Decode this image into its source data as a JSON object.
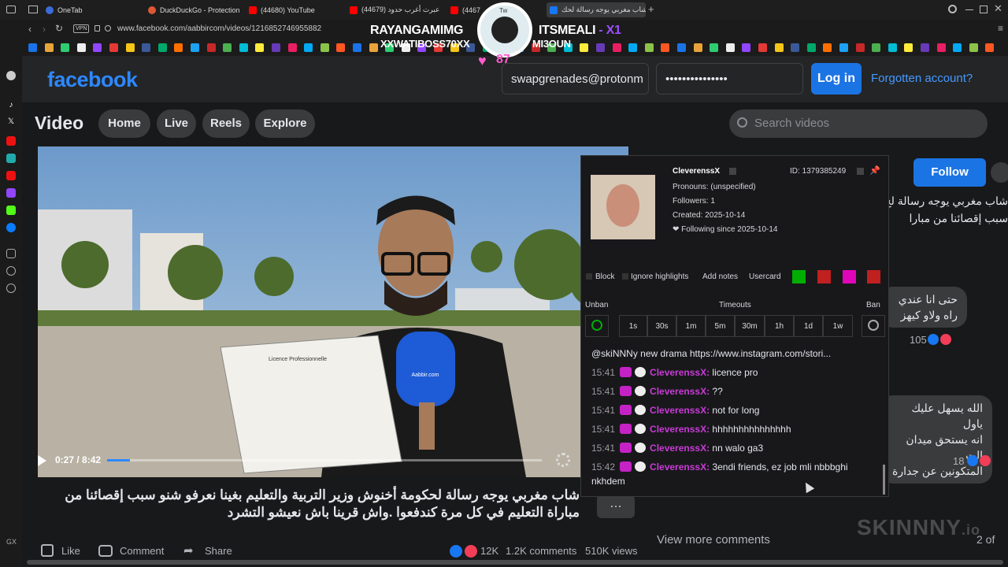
{
  "browser": {
    "tabs": [
      {
        "label": "OneTab",
        "color": "#3b6bd8"
      },
      {
        "label": "DuckDuckGo - Protection",
        "color": "#de5833"
      },
      {
        "label": "(44680) YouTube",
        "color": "#ff0000"
      },
      {
        "label": "(44679) عبرت أغرب حدود",
        "color": "#ff0000"
      },
      {
        "label": "(4467",
        "color": "#ff0000"
      },
      {
        "label": "شاب مغربي يوجه رسالة لحك",
        "color": "#1877f2"
      }
    ],
    "vpn_label": "VPN",
    "url": "www.facebook.com/aabbircom/videos/1216852746955882"
  },
  "overlay": {
    "left_name": "RAYANGAMIMG",
    "left_sub": "XXWATIBOSS70XX",
    "right_name": "ITSMEALI",
    "right_suffix": " - X1",
    "right_sub": "MI3OUN",
    "heart_count": "87",
    "avatar_label": "Tw",
    "watermark": "SKINNNY",
    "watermark_suffix": ".io"
  },
  "fb": {
    "logo": "facebook",
    "email": "swapgrenades@protonm",
    "password": "•••••••••••••••",
    "login_label": "Log in",
    "forgot_label": "Forgotten account?",
    "section_title": "Video",
    "nav": [
      "Home",
      "Live",
      "Reels",
      "Explore"
    ],
    "search_placeholder": "Search videos",
    "follow_label": "Follow",
    "video": {
      "time": "0:27 / 8:42",
      "progress": 0.052,
      "mic_label": "Aabbir.com",
      "certificate_title": "Licence Professionnelle"
    },
    "caption": "شاب مغربي يوجه رسالة لحكومة أخنوش وزير التربية والتعليم بغينا نعرفو شنو سبب إقصائنا من مباراة التعليم في كل مرة كندفعوا .واش قرينا باش نعيشو التشرد",
    "actions": {
      "like": "Like",
      "comment": "Comment",
      "share": "Share"
    },
    "stats": {
      "reactions": "12K",
      "comments": "1.2K comments",
      "views": "510K views"
    },
    "right_title": "شاب مغربي يوجه رسالة لح\nسبب إقصائنا من مبارا",
    "comments": [
      {
        "text": "حتى انا عندي\nراه ولاو كيهز",
        "count": "105"
      },
      {
        "text": "الله يسهل عليك ياول\nانه يستحق ميدان الت\nالمتكونين عن جدارة",
        "count": "18"
      }
    ],
    "view_more": "View more comments",
    "page_count": "2 of"
  },
  "usercard": {
    "username": "CleverenssX",
    "id_label": "ID: 1379385249",
    "pronouns": "Pronouns: (unspecified)",
    "followers": "Followers: 1",
    "created": "Created: 2025-10-14",
    "following": "❤ Following since 2025-10-14",
    "block": "Block",
    "ignore": "Ignore highlights",
    "add_notes": "Add notes",
    "usercard_label": "Usercard",
    "unban": "Unban",
    "timeouts": "Timeouts",
    "ban": "Ban",
    "timeout_options": [
      "1s",
      "30s",
      "1m",
      "5m",
      "30m",
      "1h",
      "1d",
      "1w"
    ],
    "chat_header": "@skiNNNy new drama https://www.instagram.com/stori...",
    "messages": [
      {
        "time": "15:41",
        "user": "CleverenssX:",
        "text": "licence pro"
      },
      {
        "time": "15:41",
        "user": "CleverenssX:",
        "text": "??"
      },
      {
        "time": "15:41",
        "user": "CleverenssX:",
        "text": "not for long"
      },
      {
        "time": "15:41",
        "user": "CleverenssX:",
        "text": "hhhhhhhhhhhhhhh"
      },
      {
        "time": "15:41",
        "user": "CleverenssX:",
        "text": "nn walo ga3"
      },
      {
        "time": "15:42",
        "user": "CleverenssX:",
        "text": "3endi friends, ez job mli nbbbghi"
      }
    ],
    "last_wrap": "nkhdem"
  },
  "sidebar_titles": [
    "X (Twitter)",
    "Tiktok"
  ]
}
